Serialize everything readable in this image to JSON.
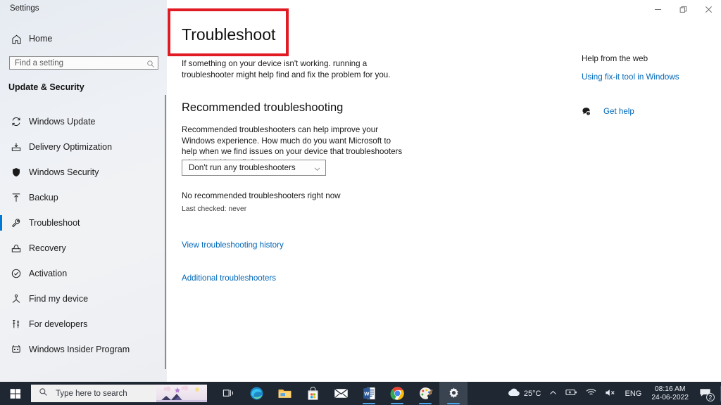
{
  "window": {
    "title": "Settings",
    "controls": [
      {
        "name": "minimize",
        "glyph": "minimize-icon"
      },
      {
        "name": "restore",
        "glyph": "restore-icon"
      },
      {
        "name": "close",
        "glyph": "close-icon"
      }
    ]
  },
  "sidebar": {
    "home_label": "Home",
    "home_icon": "home-icon",
    "search": {
      "placeholder": "Find a setting",
      "value": "",
      "icon": "search-icon"
    },
    "section_header": "Update & Security",
    "items": [
      {
        "label": "Windows Update",
        "icon": "refresh-icon",
        "active": false
      },
      {
        "label": "Delivery Optimization",
        "icon": "delivery-icon",
        "active": false
      },
      {
        "label": "Windows Security",
        "icon": "shield-icon",
        "active": false
      },
      {
        "label": "Backup",
        "icon": "upload-arrow-icon",
        "active": false
      },
      {
        "label": "Troubleshoot",
        "icon": "wrench-icon",
        "active": true
      },
      {
        "label": "Recovery",
        "icon": "recovery-icon",
        "active": false
      },
      {
        "label": "Activation",
        "icon": "check-circle-icon",
        "active": false
      },
      {
        "label": "Find my device",
        "icon": "locate-device-icon",
        "active": false
      },
      {
        "label": "For developers",
        "icon": "developer-tools-icon",
        "active": false
      },
      {
        "label": "Windows Insider Program",
        "icon": "insider-icon",
        "active": false
      }
    ]
  },
  "main": {
    "page_title": "Troubleshoot",
    "highlight_color": "#e01b24",
    "intro": "If something on your device isn't working. running a troubleshooter might help find and fix the problem for you.",
    "recommended": {
      "heading": "Recommended troubleshooting",
      "description": "Recommended troubleshooters can help improve your Windows experience. How much do you want Microsoft to help when we find issues on your device that troubleshooters might be able to fix?",
      "dropdown_value": "Don't run any troubleshooters",
      "dropdown_icon": "chevron-down-icon",
      "status": "No recommended troubleshooters right now",
      "last_checked": "Last checked: never"
    },
    "links": [
      {
        "label": "View troubleshooting history"
      },
      {
        "label": "Additional troubleshooters"
      }
    ],
    "link_color": "#0067b8"
  },
  "help_panel": {
    "title": "Help from the web",
    "web_link": "Using fix-it tool in Windows",
    "get_help_label": "Get help",
    "get_help_icon": "question-bubble-icon"
  },
  "taskbar": {
    "start_icon": "windows-start-icon",
    "search": {
      "placeholder": "Type here to search",
      "icon": "search-icon"
    },
    "apps": [
      {
        "name": "task-view",
        "icon": "task-view-icon",
        "open": false,
        "active": false
      },
      {
        "name": "microsoft-edge",
        "icon": "edge-icon",
        "open": false,
        "active": false
      },
      {
        "name": "file-explorer",
        "icon": "folder-icon",
        "open": false,
        "active": false
      },
      {
        "name": "microsoft-store",
        "icon": "store-icon",
        "open": false,
        "active": false
      },
      {
        "name": "mail",
        "icon": "mail-icon",
        "open": false,
        "active": false
      },
      {
        "name": "microsoft-word",
        "icon": "word-icon",
        "open": true,
        "active": false
      },
      {
        "name": "google-chrome",
        "icon": "chrome-icon",
        "open": true,
        "active": false
      },
      {
        "name": "paint",
        "icon": "paint-palette-icon",
        "open": true,
        "active": false
      },
      {
        "name": "settings",
        "icon": "gear-icon",
        "open": true,
        "active": true
      }
    ],
    "tray": {
      "weather_icon": "cloud-icon",
      "weather": "25°C",
      "overflow_icon": "chevron-up-icon",
      "battery_icon": "battery-icon",
      "network_icon": "wifi-icon",
      "volume_icon": "speaker-muted-icon",
      "language": "ENG",
      "time": "08:16 AM",
      "date": "24-06-2022",
      "notification_icon": "notification-icon",
      "notification_count": "2"
    }
  }
}
